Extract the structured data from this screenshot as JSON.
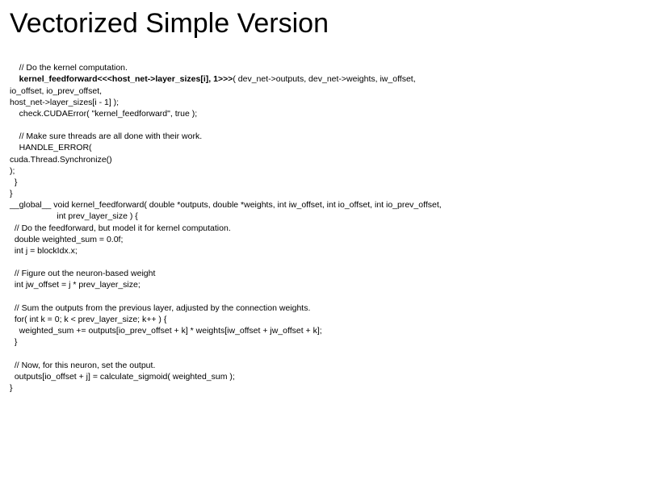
{
  "title": "Vectorized Simple Version",
  "code": {
    "l01": "    // Do the kernel computation.",
    "l02a": "    kernel_feedforward<<<host_net->layer_sizes[i], 1>>>",
    "l02b": "( dev_net->outputs, dev_net->weights, iw_offset,",
    "l03": "io_offset, io_prev_offset,",
    "l04": "host_net->layer_sizes[i - 1] );",
    "l05": "    check.CUDAError( \"kernel_feedforward\", true );",
    "l06": "",
    "l07": "    // Make sure threads are all done with their work.",
    "l08": "    HANDLE_ERROR(",
    "l09": "cuda.Thread.Synchronize()",
    "l10": ");",
    "l11": "  }",
    "l12": "}",
    "l13": "__global__ void kernel_feedforward( double *outputs, double *weights, int iw_offset, int io_offset, int io_prev_offset,",
    "l14": "                    int prev_layer_size ) {",
    "l15": "  // Do the feedforward, but model it for kernel computation.",
    "l16": "  double weighted_sum = 0.0f;",
    "l17": "  int j = blockIdx.x;",
    "l18": "",
    "l19": "  // Figure out the neuron-based weight",
    "l20": "  int jw_offset = j * prev_layer_size;",
    "l21": "",
    "l22": "  // Sum the outputs from the previous layer, adjusted by the connection weights.",
    "l23": "  for( int k = 0; k < prev_layer_size; k++ ) {",
    "l24": "    weighted_sum += outputs[io_prev_offset + k] * weights[iw_offset + jw_offset + k];",
    "l25": "  }",
    "l26": "",
    "l27": "  // Now, for this neuron, set the output.",
    "l28": "  outputs[io_offset + j] = calculate_sigmoid( weighted_sum );",
    "l29": "}"
  }
}
